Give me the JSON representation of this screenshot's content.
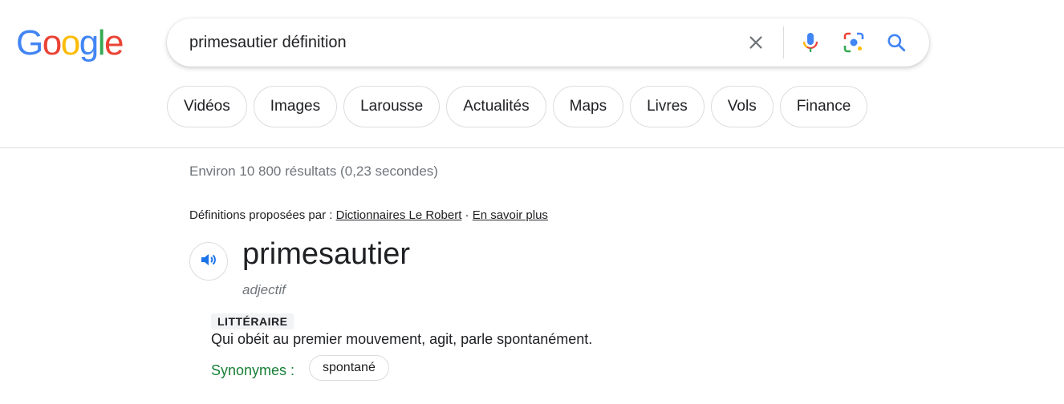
{
  "logo": {
    "letters": [
      "G",
      "o",
      "o",
      "g",
      "l",
      "e"
    ],
    "colors": [
      "#4285f4",
      "#ea4335",
      "#fbbc05",
      "#4285f4",
      "#34a853",
      "#ea4335"
    ]
  },
  "search": {
    "value": "primesautier définition",
    "icons": [
      "close-icon",
      "microphone-icon",
      "lens-icon",
      "search-icon"
    ]
  },
  "chips": [
    "Vidéos",
    "Images",
    "Larousse",
    "Actualités",
    "Maps",
    "Livres",
    "Vols",
    "Finance"
  ],
  "result_stats": "Environ 10 800 résultats (0,23 secondes)",
  "definition_block": {
    "source_prefix": "Définitions proposées par : ",
    "source_link": "Dictionnaires Le Robert",
    "separator": " · ",
    "more_link": "En savoir plus",
    "speaker_icon": "speaker-icon",
    "headword": "primesautier",
    "part_of_speech": "adjectif",
    "register_label": "LITTÉRAIRE",
    "definition": "Qui obéit au premier mouvement, agit, parle spontanément.",
    "synonyms_label": "Synonymes :",
    "synonyms": [
      "spontané"
    ]
  },
  "colors": {
    "link_blue": "#1a73e8",
    "synonym_green": "#188038",
    "muted_text": "#70757a"
  }
}
